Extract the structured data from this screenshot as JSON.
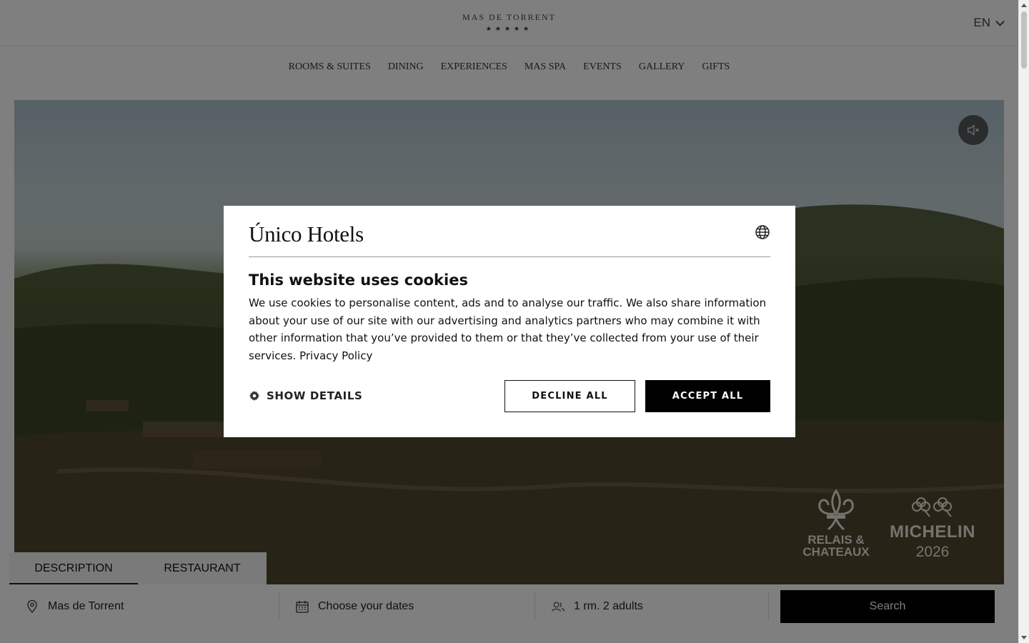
{
  "header": {
    "logo_name": "MAS DE TORRENT",
    "logo_stars": "★★★★★",
    "language": "EN"
  },
  "nav": {
    "items": [
      "ROOMS & SUITES",
      "DINING",
      "EXPERIENCES",
      "MAS SPA",
      "EVENTS",
      "GALLERY",
      "GIFTS"
    ]
  },
  "hero": {
    "mute_icon": "speaker-muted-icon",
    "relais_badge": "RELAIS & CHATEAUX",
    "michelin_name": "MICHELIN",
    "michelin_year": "2026"
  },
  "tabs": {
    "items": [
      "DESCRIPTION",
      "RESTAURANT"
    ],
    "active": "DESCRIPTION"
  },
  "booking": {
    "location": "Mas de Torrent",
    "dates": "Choose your dates",
    "guests": "1 rm. 2 adults",
    "search_label": "Search"
  },
  "cookie_modal": {
    "brand": "Único Hotels",
    "title": "This website uses cookies",
    "body": "We use cookies to personalise content, ads and to analyse our traffic. We also share information about your use of our site with our advertising and analytics partners who may combine it with other information that you’ve provided to them or that they’ve collected from your use of their services.",
    "privacy_link": "Privacy Policy",
    "show_details": "SHOW DETAILS",
    "decline": "DECLINE ALL",
    "accept": "ACCEPT ALL"
  },
  "colors": {
    "overlay": "#000000",
    "button_primary": "#000000",
    "text": "#111111"
  }
}
